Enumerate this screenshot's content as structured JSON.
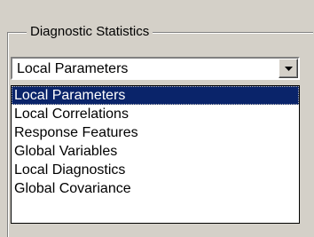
{
  "group": {
    "title": "Diagnostic Statistics"
  },
  "combo": {
    "value": "Local Parameters",
    "button_icon": "dropdown-arrow-icon"
  },
  "list": {
    "items": [
      "Local Parameters",
      "Local Correlations",
      "Response Features",
      "Global Variables",
      "Local Diagnostics",
      "Global Covariance"
    ],
    "selected_index": 0
  },
  "colors": {
    "selection_bg": "#0a246a",
    "selection_fg": "#ffffff",
    "dialog_bg": "#d4d0c8"
  }
}
